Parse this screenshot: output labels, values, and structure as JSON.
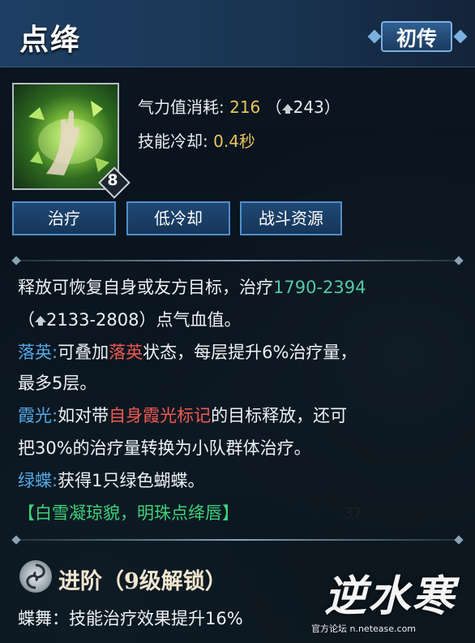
{
  "skill": {
    "name": "点绛",
    "rank": "初传",
    "level": "8"
  },
  "stats": {
    "energy_label": "气力值消耗:",
    "energy_value": "216",
    "energy_paren_open": "（",
    "energy_upgraded": "243",
    "energy_paren_close": "）",
    "cooldown_label": "技能冷却:",
    "cooldown_value": "0.4秒"
  },
  "tags": [
    "治疗",
    "低冷却",
    "战斗资源"
  ],
  "description": {
    "line1_text": "释放可恢复自身或友方目标，治疗",
    "line1_value": "1790-2394",
    "line2_open": "（",
    "line2_value": "2133-2808",
    "line2_close": "）点气血值。",
    "luoying_label": "落英:",
    "luoying_text1": "可叠加",
    "luoying_keyword": "落英",
    "luoying_text2": "状态，每层提升6%治疗量，",
    "luoying_line2": "最多5层。",
    "xiaguang_label": "霞光:",
    "xiaguang_text1": "如对带",
    "xiaguang_keyword": "自身霞光标记",
    "xiaguang_text2": "的目标释放，还可",
    "xiaguang_line2": "把30%的治疗量转换为小队群体治疗。",
    "lvdie_label": "绿蝶:",
    "lvdie_text": "获得1只绿色蝴蝶。",
    "set_bonus": "【白雪凝琼貌，明珠点绛唇】"
  },
  "advance": {
    "title": "进阶（9级解锁）",
    "line1": "蝶舞：技能治疗效果提升16%"
  },
  "watermark": {
    "brand": "逆水寒",
    "site": "官方论坛 n.netease.com"
  },
  "background": {
    "number": "37"
  },
  "colors": {
    "value_gold": "#e9c45c",
    "value_teal": "#52c9a4",
    "label_blue": "#56a8e8",
    "keyword_red": "#f05a52",
    "set_green": "#3fd17a"
  }
}
